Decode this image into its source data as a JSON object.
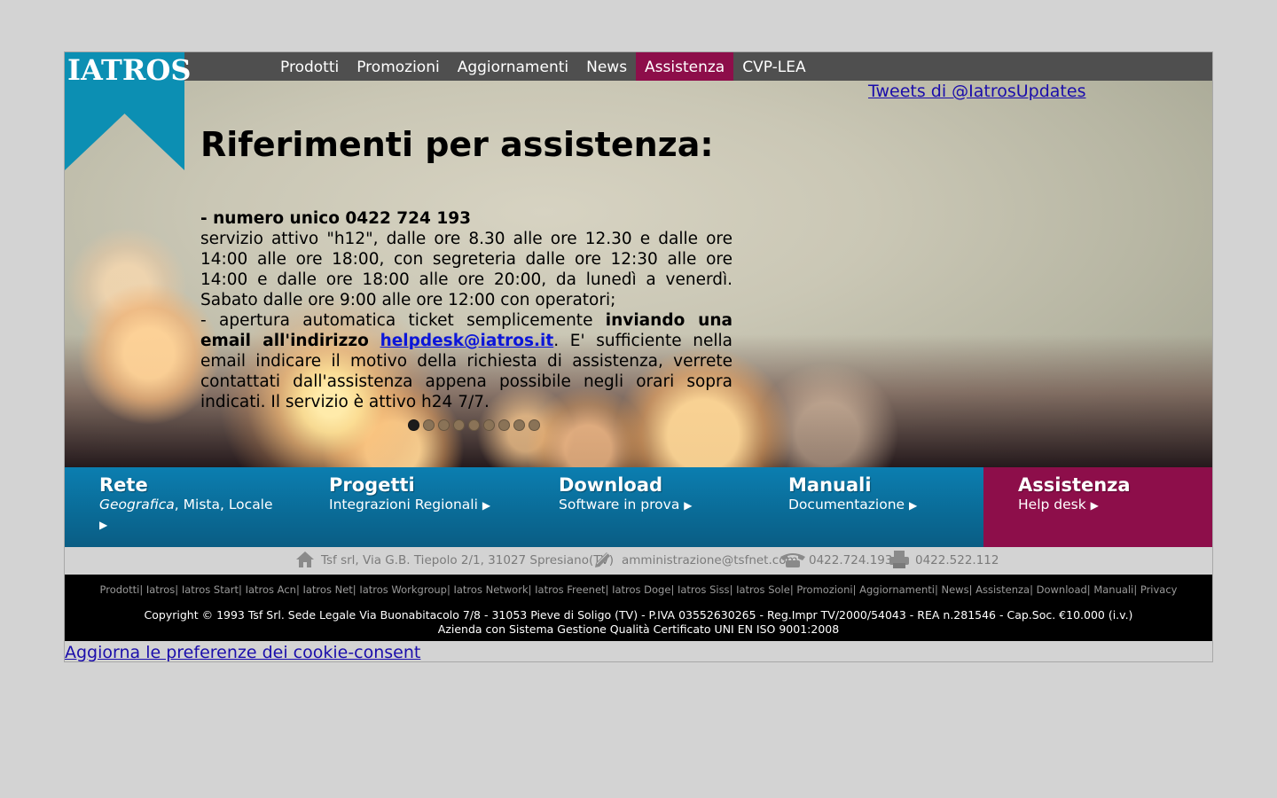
{
  "logo": {
    "text": "IATROS"
  },
  "nav": {
    "items": [
      {
        "label": "Prodotti"
      },
      {
        "label": "Promozioni"
      },
      {
        "label": "Aggiornamenti"
      },
      {
        "label": "News"
      },
      {
        "label": "Assistenza",
        "active": true
      },
      {
        "label": "CVP-LEA"
      }
    ]
  },
  "tweets_link": "Tweets di @IatrosUpdates",
  "main": {
    "heading": "Riferimenti per assistenza:",
    "phone_line": "- numero unico 0422 724 193",
    "service_text": "servizio attivo \"h12\", dalle ore 8.30 alle ore 12.30 e dalle ore 14:00 alle ore 18:00, con segreteria dalle ore 12:30 alle ore 14:00 e dalle ore 18:00 alle ore 20:00, da lunedì a venerdì. Sabato dalle ore 9:00 alle ore 12:00 con operatori;",
    "ticket_prefix": "- apertura automatica ticket semplicemente ",
    "ticket_bold": "inviando una email all'indirizzo",
    "email": "helpdesk@iatros.it",
    "ticket_suffix": ". E' sufficiente nella email indicare il motivo della richiesta di assistenza, verrete contattati dall'assistenza appena possibile negli orari sopra indicati. Il servizio è attivo h24 7/7."
  },
  "slider": {
    "dot_count": 9,
    "active_index": 0
  },
  "tiles": [
    {
      "title": "Rete",
      "sub_italic": "Geografica",
      "sub": ", Mista, Locale"
    },
    {
      "title": "Progetti",
      "sub": "Integrazioni Regionali"
    },
    {
      "title": "Download",
      "sub": "Software in prova"
    },
    {
      "title": "Manuali",
      "sub": "Documentazione"
    },
    {
      "title": "Assistenza",
      "sub": "Help desk"
    }
  ],
  "contact": {
    "address": "Tsf srl, Via G.B. Tiepolo 2/1, 31027 Spresiano(TV)",
    "email": "amministrazione@tsfnet.com",
    "phone": "0422.724.193",
    "fax": "0422.522.112"
  },
  "footer": {
    "links": [
      "Prodotti",
      "Iatros",
      "Iatros Start",
      "Iatros Acn",
      "Iatros Net",
      "Iatros Workgroup",
      "Iatros Network",
      "Iatros Freenet",
      "Iatros Doge",
      "Iatros Siss",
      "Iatros Sole",
      "Promozioni",
      "Aggiornamenti",
      "News",
      "Assistenza",
      "Download",
      "Manuali",
      "Privacy"
    ],
    "copyright": "Copyright © 1993 Tsf Srl. Sede Legale Via Buonabitacolo 7/8 - 31053 Pieve di Soligo (TV) - P.IVA 03552630265 - Reg.Impr TV/2000/54043 - REA n.281546 - Cap.Soc. €10.000 (i.v.)",
    "quality": "Azienda con Sistema Gestione Qualità Certificato UNI EN ISO 9001:2008"
  },
  "cookie_link": "Aggiorna le preferenze dei cookie-consent",
  "colors": {
    "brand_blue": "#0c8fb3",
    "accent_magenta": "#8d0e4a",
    "tile_blue": "#0b7eb0",
    "nav_bar": "#4f4f4f"
  },
  "icons": [
    "home-icon",
    "pencil-icon",
    "phone-icon",
    "fax-icon",
    "triangle-right-icon"
  ]
}
